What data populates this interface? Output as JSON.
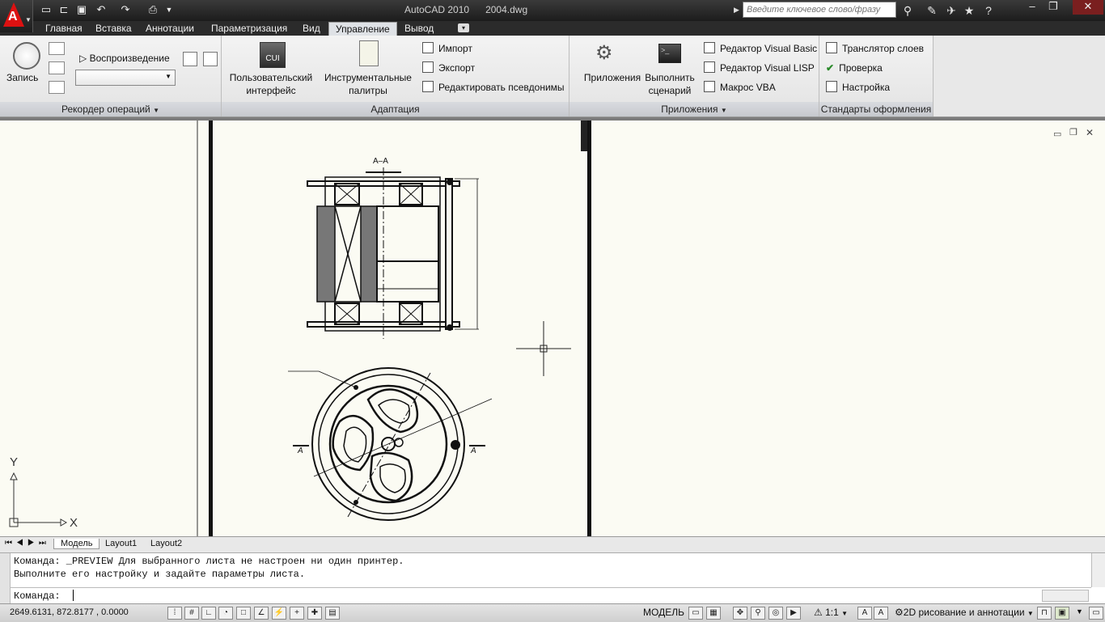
{
  "title_bar": {
    "app_name": "AutoCAD 2010",
    "file_name": "2004.dwg",
    "search_placeholder": "Введите ключевое слово/фразу"
  },
  "tabs": [
    {
      "label": "Главная"
    },
    {
      "label": "Вставка"
    },
    {
      "label": "Аннотации"
    },
    {
      "label": "Параметризация"
    },
    {
      "label": "Вид"
    },
    {
      "label": "Управление",
      "active": true
    },
    {
      "label": "Вывод"
    }
  ],
  "ribbon": {
    "recorder": {
      "title": "Рекордер операций",
      "record_label": "Запись",
      "play_label": "Воспроизведение"
    },
    "customize": {
      "title": "Адаптация",
      "ui_label_1": "Пользовательский",
      "ui_label_2": "интерфейс",
      "cui_icon_text": "CUI",
      "palettes_label_1": "Инструментальные",
      "palettes_label_2": "палитры",
      "import_label": "Импорт",
      "export_label": "Экспорт",
      "aliases_label": "Редактировать псевдонимы"
    },
    "apps": {
      "title": "Приложения",
      "apps_label": "Приложения",
      "run_label_1": "Выполнить",
      "run_label_2": "сценарий",
      "vba_editor": "Редактор Visual Basic",
      "lisp_editor": "Редактор Visual LISP",
      "vba_macro": "Макрос VBA"
    },
    "standards": {
      "title": "Стандарты оформления",
      "layer_translator": "Транслятор  слоев",
      "check": "Проверка",
      "configure": "Настройка"
    }
  },
  "drawing": {
    "section_label": "А–А",
    "section_mark_left": "А",
    "section_mark_right": "А",
    "ucs_x": "X",
    "ucs_y": "Y"
  },
  "layout_tabs": [
    {
      "label": "Модель",
      "active": true
    },
    {
      "label": "Layout1"
    },
    {
      "label": "Layout2"
    }
  ],
  "command": {
    "line1": "Команда: _PREVIEW Для выбранного листа не настроен ни один принтер.",
    "line2": "Выполните его настройку и задайте параметры листа.",
    "prompt": "Команда:"
  },
  "status": {
    "coords": "2649.6131, 872.8177 , 0.0000",
    "model_label": "МОДЕЛЬ",
    "scale": "1:1",
    "workspace": "2D рисование и аннотации"
  },
  "colors": {
    "accent_tab": "#dfe2e6",
    "dark_bar": "#2b2b2b",
    "canvas": "#fbfbf3"
  }
}
